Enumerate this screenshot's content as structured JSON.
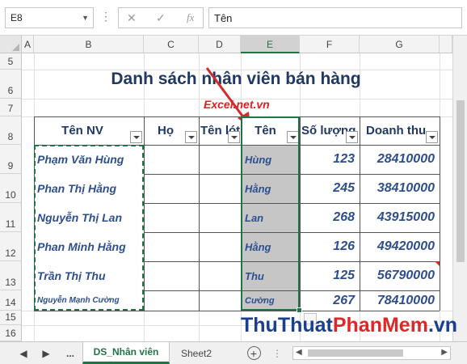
{
  "formula_bar": {
    "name_box": "E8",
    "fx_label": "fx",
    "formula": "Tên"
  },
  "columns": [
    "A",
    "B",
    "C",
    "D",
    "E",
    "F",
    "G"
  ],
  "rows": [
    "5",
    "6",
    "7",
    "8",
    "9",
    "10",
    "11",
    "12",
    "13",
    "14",
    "15",
    "16"
  ],
  "sheet": {
    "title": "Danh sách nhân viên bán hàng",
    "watermark": "Excel.net.vn",
    "headers": [
      "Tên NV",
      "Họ",
      "Tên lót",
      "Tên",
      "Số lượng",
      "Doanh thu"
    ],
    "records": [
      {
        "full_name": "Phạm Văn Hùng",
        "ho": "",
        "ten_lot": "",
        "ten": "Hùng",
        "so_luong": "123",
        "doanh_thu": "28410000"
      },
      {
        "full_name": "Phan Thị Hằng",
        "ho": "",
        "ten_lot": "",
        "ten": "Hằng",
        "so_luong": "245",
        "doanh_thu": "38410000"
      },
      {
        "full_name": "Nguyễn Thị Lan",
        "ho": "",
        "ten_lot": "",
        "ten": "Lan",
        "so_luong": "268",
        "doanh_thu": "43915000"
      },
      {
        "full_name": "Phan Minh Hằng",
        "ho": "",
        "ten_lot": "",
        "ten": "Hằng",
        "so_luong": "126",
        "doanh_thu": "49420000"
      },
      {
        "full_name": "Trần Thị Thu",
        "ho": "",
        "ten_lot": "",
        "ten": "Thu",
        "so_luong": "125",
        "doanh_thu": "56790000"
      },
      {
        "full_name": "Nguyễn Mạnh Cường",
        "ho": "",
        "ten_lot": "",
        "ten": "Cường",
        "so_luong": "267",
        "doanh_thu": "78410000"
      }
    ]
  },
  "tabs": {
    "ellipsis": "...",
    "sheets": [
      "DS_Nhân viên",
      "Sheet2"
    ],
    "active": "DS_Nhân viên",
    "add_label": "+"
  },
  "brand": {
    "part1": "ThuThuat",
    "part2": "PhanMem",
    "part3": ".vn"
  },
  "colors": {
    "accent": "#217346",
    "title": "#1f3864",
    "watermark": "#e02020"
  }
}
